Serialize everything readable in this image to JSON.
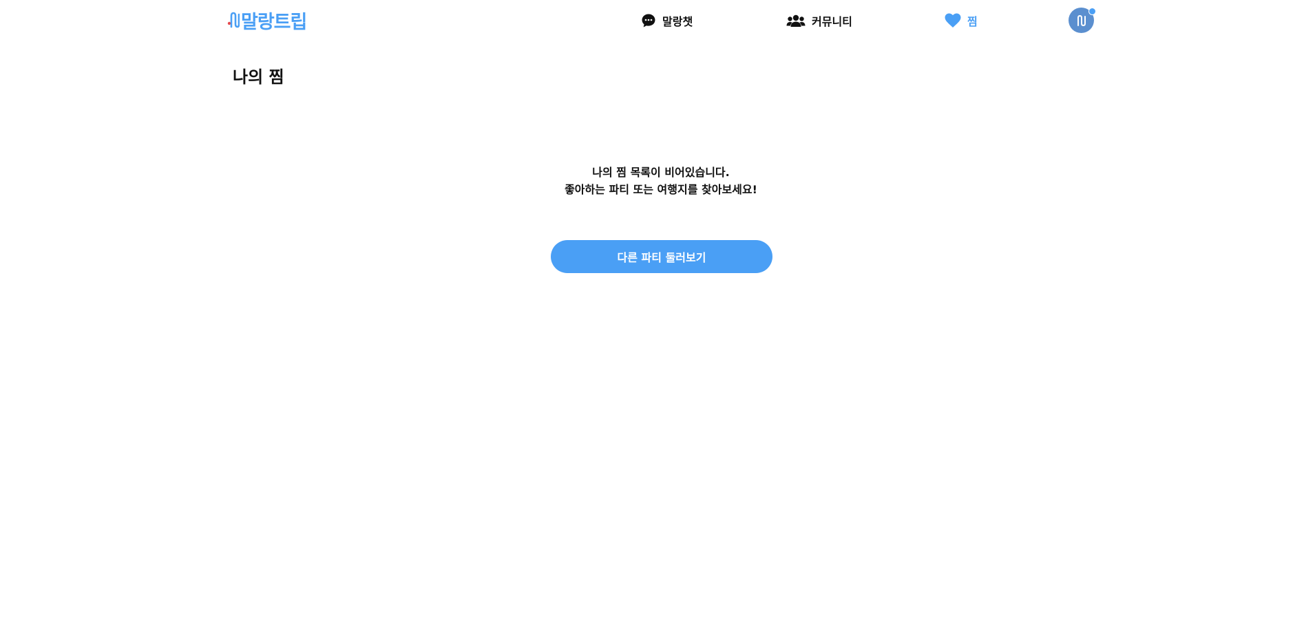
{
  "header": {
    "logo_text": "말랑트립",
    "nav": [
      {
        "label": "말랑챗",
        "icon": "chat-bubble-icon"
      },
      {
        "label": "커뮤니티",
        "icon": "users-icon"
      },
      {
        "label": "찜",
        "icon": "heart-icon",
        "active": true
      }
    ],
    "avatar": {
      "icon": "logo-mark-icon",
      "has_notification": true
    }
  },
  "main": {
    "title": "나의 찜",
    "empty_line1": "나의 찜 목록이 비어있습니다.",
    "empty_line2": "좋아하는 파티 또는 여행지를 찾아보세요!",
    "button_label": "다른 파티 둘러보기"
  },
  "colors": {
    "accent": "#4a9ff5",
    "avatar_bg": "#5b8fcf",
    "text": "#111111",
    "logo_dot": "#e5484d"
  }
}
